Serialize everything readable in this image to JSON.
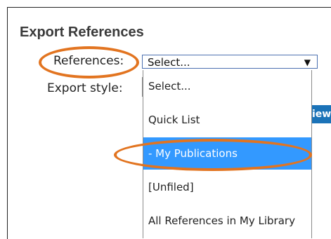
{
  "dialog": {
    "title": "Export References",
    "references_label": "References:",
    "export_style_label": "Export style:",
    "references_select": {
      "selected_value": "Select...",
      "arrow": "▼"
    },
    "partial_button_label": "iew",
    "dropdown_options": [
      {
        "label": "Select..."
      },
      {
        "label": "Quick List"
      },
      {
        "label": "- My Publications",
        "highlighted": true
      },
      {
        "label": "[Unfiled]"
      },
      {
        "label": "All References in My Library"
      }
    ]
  },
  "annotation": {
    "color": "#e27420"
  },
  "colors": {
    "highlight": "#3399ff",
    "button": "#1b73b8"
  }
}
